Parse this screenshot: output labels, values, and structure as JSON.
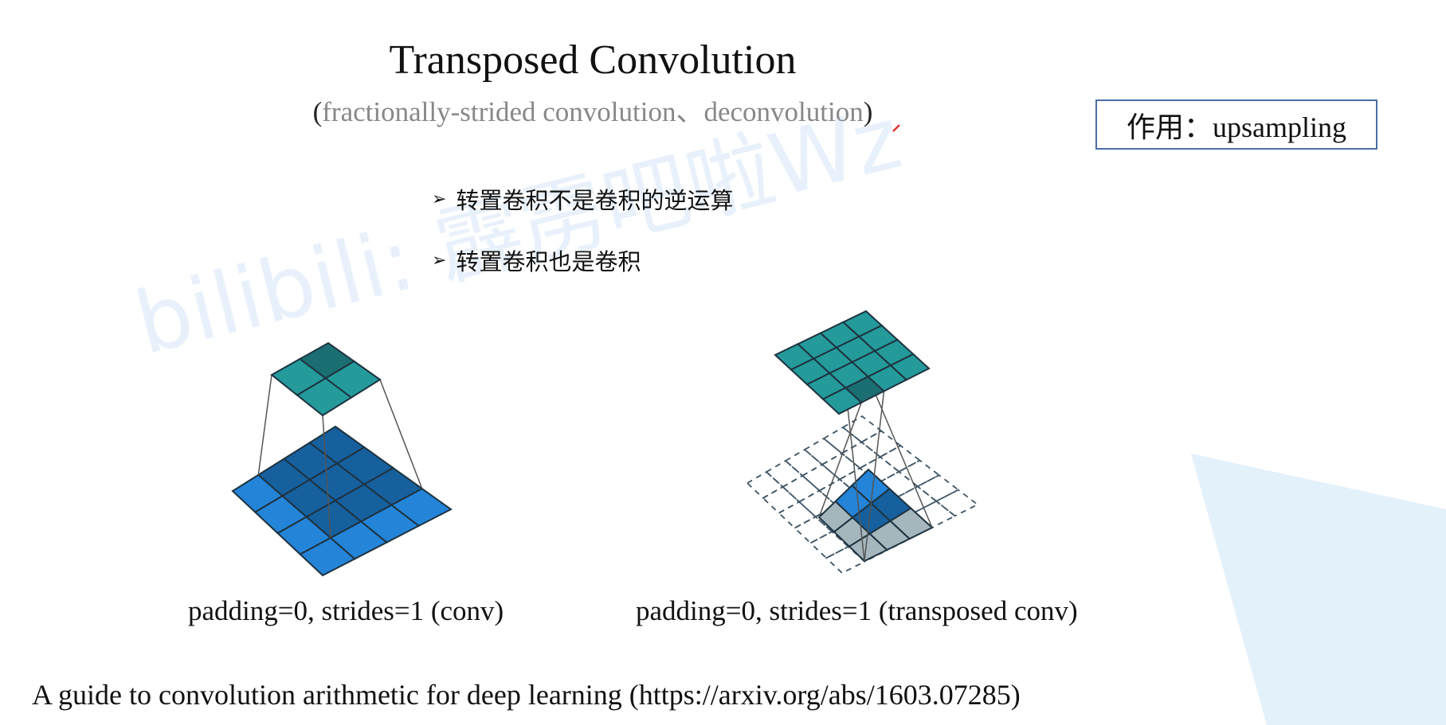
{
  "slide": {
    "title": "Transposed Convolution",
    "subtitle_open": "(",
    "subtitle": "fractionally-strided convolution、deconvolution",
    "subtitle_close": ")",
    "purpose_box": "作用：upsampling",
    "bullets": [
      "转置卷积不是卷积的逆运算",
      "转置卷积也是卷积"
    ],
    "captions": [
      "padding=0, strides=1 (conv)",
      "padding=0, strides=1 (transposed conv)"
    ],
    "reference": "A guide to convolution arithmetic for deep learning (https://arxiv.org/abs/1603.07285)",
    "watermark": "bilibili: 霹雳吧啦Wz"
  },
  "colors": {
    "teal": "#249a9b",
    "teal_dark": "#1b6f73",
    "blue": "#2484d8",
    "blue_dark": "#16609e",
    "gray": "#a5b6bd",
    "box_border": "#4a6fa5"
  }
}
